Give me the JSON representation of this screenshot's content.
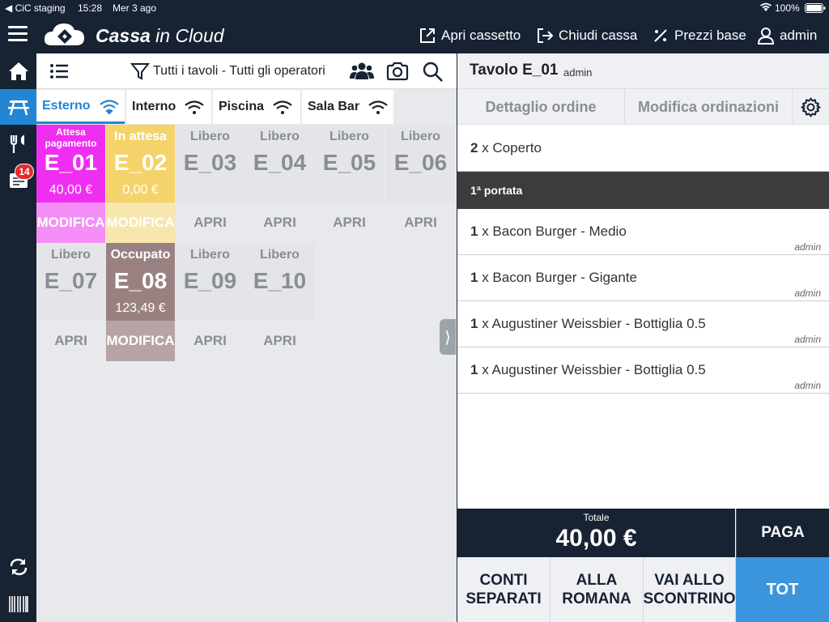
{
  "status": {
    "carrier": "◀ CiC staging",
    "time": "15:28",
    "date": "Mer 3 ago",
    "battery": "100%"
  },
  "brand": {
    "name_bold": "Cassa",
    "name_rest": " in Cloud"
  },
  "topbar": {
    "open_drawer": "Apri cassetto",
    "close_register": "Chiudi cassa",
    "base_prices": "Prezzi base",
    "user": "admin"
  },
  "sidebar": {
    "badge_count": "14"
  },
  "toolbar": {
    "filter_label": "Tutti i tavoli - Tutti gli operatori"
  },
  "tabs": [
    {
      "label": "Esterno"
    },
    {
      "label": "Interno"
    },
    {
      "label": "Piscina"
    },
    {
      "label": "Sala Bar"
    }
  ],
  "tables": [
    {
      "status": "Attesa pagamento",
      "name": "E_01",
      "price": "40,00 €",
      "action": "MODIFICA"
    },
    {
      "status": "In attesa",
      "name": "E_02",
      "price": "0,00 €",
      "action": "MODIFICA"
    },
    {
      "status": "Libero",
      "name": "E_03",
      "price": "",
      "action": "APRI"
    },
    {
      "status": "Libero",
      "name": "E_04",
      "price": "",
      "action": "APRI"
    },
    {
      "status": "Libero",
      "name": "E_05",
      "price": "",
      "action": "APRI"
    },
    {
      "status": "Libero",
      "name": "E_06",
      "price": "",
      "action": "APRI"
    },
    {
      "status": "Libero",
      "name": "E_07",
      "price": "",
      "action": "APRI"
    },
    {
      "status": "Occupato",
      "name": "E_08",
      "price": "123,49 €",
      "action": "MODIFICA"
    },
    {
      "status": "Libero",
      "name": "E_09",
      "price": "",
      "action": "APRI"
    },
    {
      "status": "Libero",
      "name": "E_10",
      "price": "",
      "action": "APRI"
    }
  ],
  "handle_glyph": "⟩",
  "order": {
    "title": "Tavolo E_01",
    "operator": "admin",
    "tab_detail": "Dettaglio ordine",
    "tab_edit": "Modifica ordinazioni",
    "cover": {
      "qty": "2",
      "text": " x Coperto"
    },
    "course": "1ª portata",
    "items": [
      {
        "qty": "1",
        "text": " x Bacon Burger - Medio",
        "by": "admin"
      },
      {
        "qty": "1",
        "text": " x Bacon Burger - Gigante",
        "by": "admin"
      },
      {
        "qty": "1",
        "text": " x Augustiner Weissbier - Bottiglia 0.5",
        "by": "admin"
      },
      {
        "qty": "1",
        "text": " x Augustiner Weissbier - Bottiglia 0.5",
        "by": "admin"
      }
    ],
    "total_label": "Totale",
    "total_value": "40,00 €",
    "pay": "PAGA",
    "split": "CONTI SEPARATI",
    "roman": "ALLA ROMANA",
    "receipt": "VAI ALLO SCONTRINO",
    "tot": "TOT"
  },
  "colors": {
    "accent": "#2386d4",
    "dark": "#172233",
    "waiting_payment": "#f02ef2",
    "waiting": "#f4d36a",
    "occupied": "#9a8181"
  }
}
